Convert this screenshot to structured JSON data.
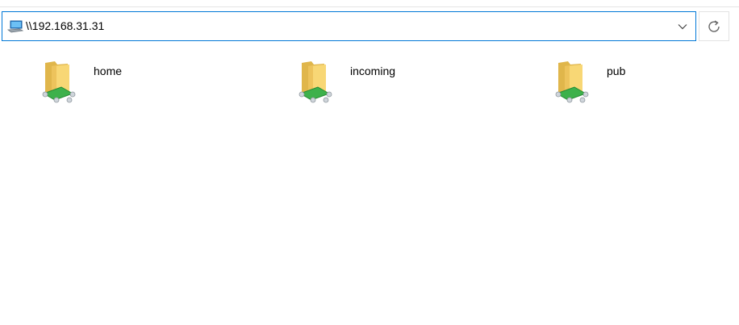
{
  "address_bar": {
    "path": "\\\\192.168.31.31",
    "location_icon": "network-computer-icon",
    "dropdown_icon": "chevron-down-icon"
  },
  "refresh_button": {
    "icon": "refresh-icon"
  },
  "items": [
    {
      "label": "home",
      "icon": "network-share-folder-icon"
    },
    {
      "label": "incoming",
      "icon": "network-share-folder-icon"
    },
    {
      "label": "pub",
      "icon": "network-share-folder-icon"
    }
  ],
  "colors": {
    "accent": "#0078d7",
    "folder_light": "#f8d775",
    "folder_dark": "#e0b64b",
    "cable_green": "#3db14b"
  }
}
